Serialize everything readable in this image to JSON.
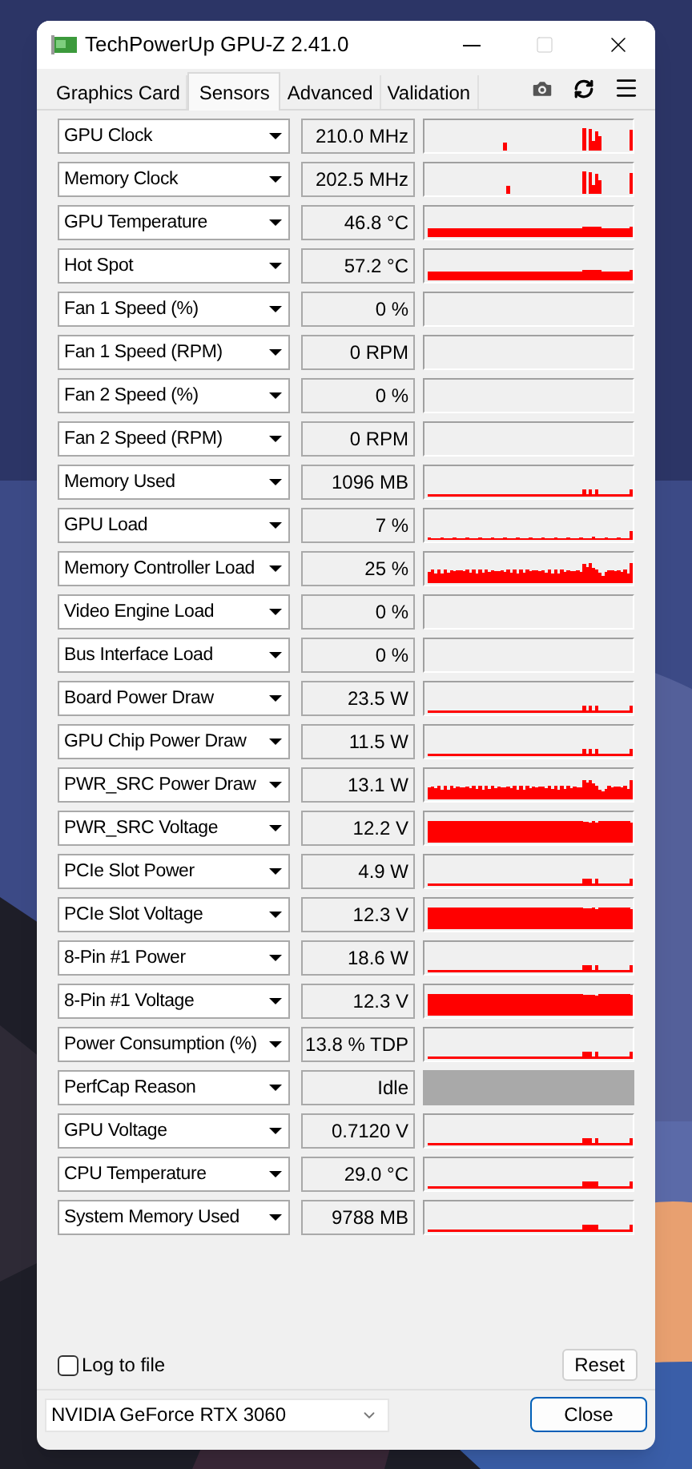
{
  "window": {
    "title": "TechPowerUp GPU-Z 2.41.0"
  },
  "tabs": [
    {
      "label": "Graphics Card",
      "selected": false
    },
    {
      "label": "Sensors",
      "selected": true
    },
    {
      "label": "Advanced",
      "selected": false
    },
    {
      "label": "Validation",
      "selected": false
    }
  ],
  "sensors": [
    {
      "name": "GPU Clock",
      "value": "210.0 MHz",
      "kind": "spiky"
    },
    {
      "name": "Memory Clock",
      "value": "202.5 MHz",
      "kind": "spiky"
    },
    {
      "name": "GPU Temperature",
      "value": "46.8 °C",
      "kind": "band"
    },
    {
      "name": "Hot Spot",
      "value": "57.2 °C",
      "kind": "band"
    },
    {
      "name": "Fan 1 Speed (%)",
      "value": "0 %",
      "kind": "empty"
    },
    {
      "name": "Fan 1 Speed (RPM)",
      "value": "0 RPM",
      "kind": "empty"
    },
    {
      "name": "Fan 2 Speed (%)",
      "value": "0 %",
      "kind": "empty"
    },
    {
      "name": "Fan 2 Speed (RPM)",
      "value": "0 RPM",
      "kind": "empty"
    },
    {
      "name": "Memory Used",
      "value": "1096 MB",
      "kind": "line"
    },
    {
      "name": "GPU Load",
      "value": "7 %",
      "kind": "sparse"
    },
    {
      "name": "Memory Controller Load",
      "value": "25 %",
      "kind": "noisy"
    },
    {
      "name": "Video Engine Load",
      "value": "0 %",
      "kind": "empty"
    },
    {
      "name": "Bus Interface Load",
      "value": "0 %",
      "kind": "empty"
    },
    {
      "name": "Board Power Draw",
      "value": "23.5 W",
      "kind": "line"
    },
    {
      "name": "GPU Chip Power Draw",
      "value": "11.5 W",
      "kind": "line"
    },
    {
      "name": "PWR_SRC Power Draw",
      "value": "13.1 W",
      "kind": "noisy"
    },
    {
      "name": "PWR_SRC Voltage",
      "value": "12.2 V",
      "kind": "full"
    },
    {
      "name": "PCIe Slot Power",
      "value": "4.9 W",
      "kind": "line"
    },
    {
      "name": "PCIe Slot Voltage",
      "value": "12.3 V",
      "kind": "full"
    },
    {
      "name": "8-Pin #1 Power",
      "value": "18.6 W",
      "kind": "line"
    },
    {
      "name": "8-Pin #1 Voltage",
      "value": "12.3 V",
      "kind": "full"
    },
    {
      "name": "Power Consumption (%)",
      "value": "13.8 % TDP",
      "kind": "line"
    },
    {
      "name": "PerfCap Reason",
      "value": "Idle",
      "kind": "idle"
    },
    {
      "name": "GPU Voltage",
      "value": "0.7120 V",
      "kind": "line"
    },
    {
      "name": "CPU Temperature",
      "value": "29.0 °C",
      "kind": "line"
    },
    {
      "name": "System Memory Used",
      "value": "9788 MB",
      "kind": "line"
    }
  ],
  "log_to_file": {
    "label": "Log to file",
    "checked": false
  },
  "reset_button": "Reset",
  "gpu_select": {
    "value": "NVIDIA GeForce RTX 3060"
  },
  "close_button": "Close"
}
